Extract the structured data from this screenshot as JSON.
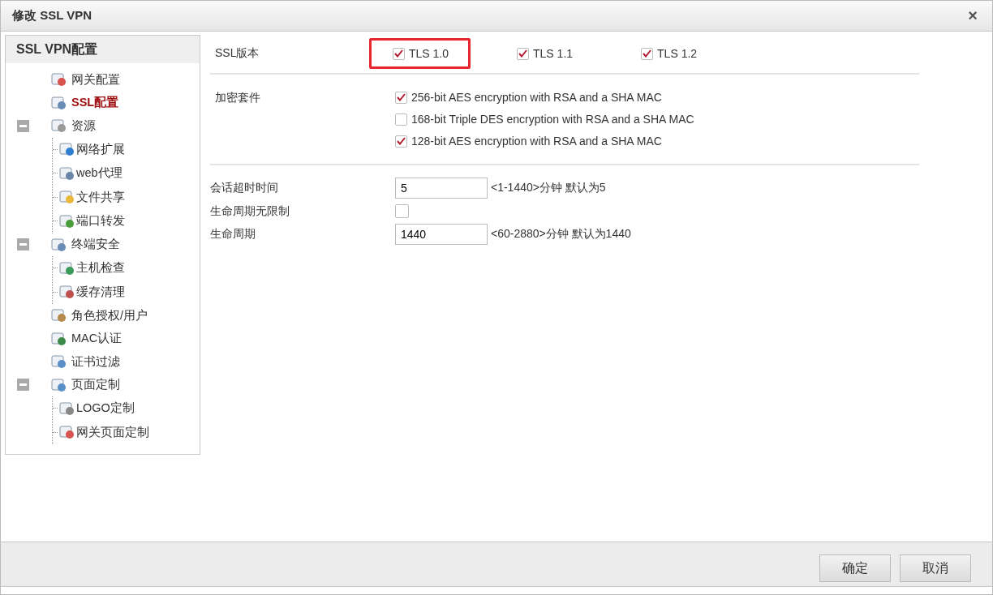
{
  "window": {
    "title": "修改 SSL VPN",
    "close": "×"
  },
  "sidebar": {
    "title": "SSL VPN配置",
    "items": [
      {
        "label": "网关配置",
        "selected": false
      },
      {
        "label": "SSL配置",
        "selected": true
      },
      {
        "label": "资源",
        "selected": false,
        "expanded": true,
        "children": [
          {
            "label": "网络扩展",
            "selected": false
          },
          {
            "label": "web代理",
            "selected": false
          },
          {
            "label": "文件共享",
            "selected": false
          },
          {
            "label": "端口转发",
            "selected": false
          }
        ]
      },
      {
        "label": "终端安全",
        "selected": false,
        "expanded": true,
        "children": [
          {
            "label": "主机检查",
            "selected": false
          },
          {
            "label": "缓存清理",
            "selected": false
          }
        ]
      },
      {
        "label": "角色授权/用户",
        "selected": false
      },
      {
        "label": "MAC认证",
        "selected": false
      },
      {
        "label": "证书过滤",
        "selected": false
      },
      {
        "label": "页面定制",
        "selected": false,
        "expanded": true,
        "children": [
          {
            "label": "LOGO定制",
            "selected": false
          },
          {
            "label": "网关页面定制",
            "selected": false
          }
        ]
      }
    ]
  },
  "ssl_version": {
    "label": "SSL版本",
    "options": [
      {
        "label": "TLS 1.0",
        "checked": true,
        "highlighted": true
      },
      {
        "label": "TLS 1.1",
        "checked": true,
        "highlighted": false
      },
      {
        "label": "TLS 1.2",
        "checked": true,
        "highlighted": false
      }
    ]
  },
  "cipher_suites": {
    "label": "加密套件",
    "options": [
      {
        "label": "256-bit AES encryption with RSA and a SHA MAC",
        "checked": true
      },
      {
        "label": "168-bit Triple DES encryption with RSA and a SHA MAC",
        "checked": false
      },
      {
        "label": "128-bit AES encryption with RSA and a SHA MAC",
        "checked": true
      }
    ]
  },
  "session": [
    {
      "kind": "input",
      "label": "会话超时时间",
      "value": "5",
      "hint": "<1-1440>分钟 默认为5"
    },
    {
      "kind": "checkbox",
      "label": "生命周期无限制",
      "checked": false
    },
    {
      "kind": "input",
      "label": "生命周期",
      "value": "1440",
      "hint": "<60-2880>分钟 默认为1440"
    }
  ],
  "buttons": [
    "确定",
    "取消"
  ]
}
